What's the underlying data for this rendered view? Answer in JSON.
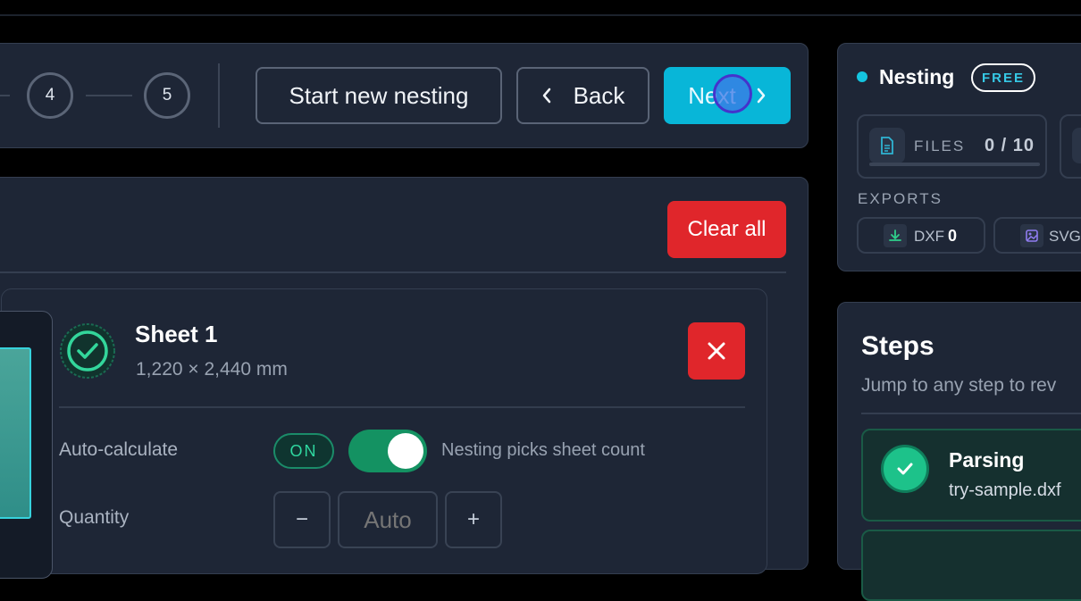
{
  "stepper": {
    "steps": [
      "4",
      "5"
    ],
    "start_new_label": "Start new nesting",
    "back_label": "Back",
    "next_label": "Next"
  },
  "main": {
    "clear_all_label": "Clear all",
    "sheet": {
      "title": "Sheet 1",
      "dimensions": "1,220 × 2,440 mm"
    },
    "auto_calculate": {
      "label": "Auto-calculate",
      "state_badge": "ON",
      "enabled": true,
      "hint": "Nesting picks sheet count"
    },
    "quantity": {
      "label": "Quantity",
      "minus": "−",
      "placeholder": "Auto",
      "plus": "+"
    }
  },
  "nesting_panel": {
    "title": "Nesting",
    "badge": "FREE",
    "files_label": "FILES",
    "files_value": "0 / 10",
    "files_progress": 0,
    "exports_label": "EXPORTS",
    "exports": [
      {
        "label": "DXF",
        "count": "0"
      },
      {
        "label": "SVG",
        "count": ""
      }
    ]
  },
  "steps_panel": {
    "title": "Steps",
    "subtitle": "Jump to any step to rev",
    "items": [
      {
        "title": "Parsing",
        "detail": "try-sample.dxf"
      }
    ]
  },
  "colors": {
    "accent": "#08b6d8",
    "danger": "#e0262b",
    "success": "#1dc28a",
    "status_dot": "#14c5e0"
  }
}
